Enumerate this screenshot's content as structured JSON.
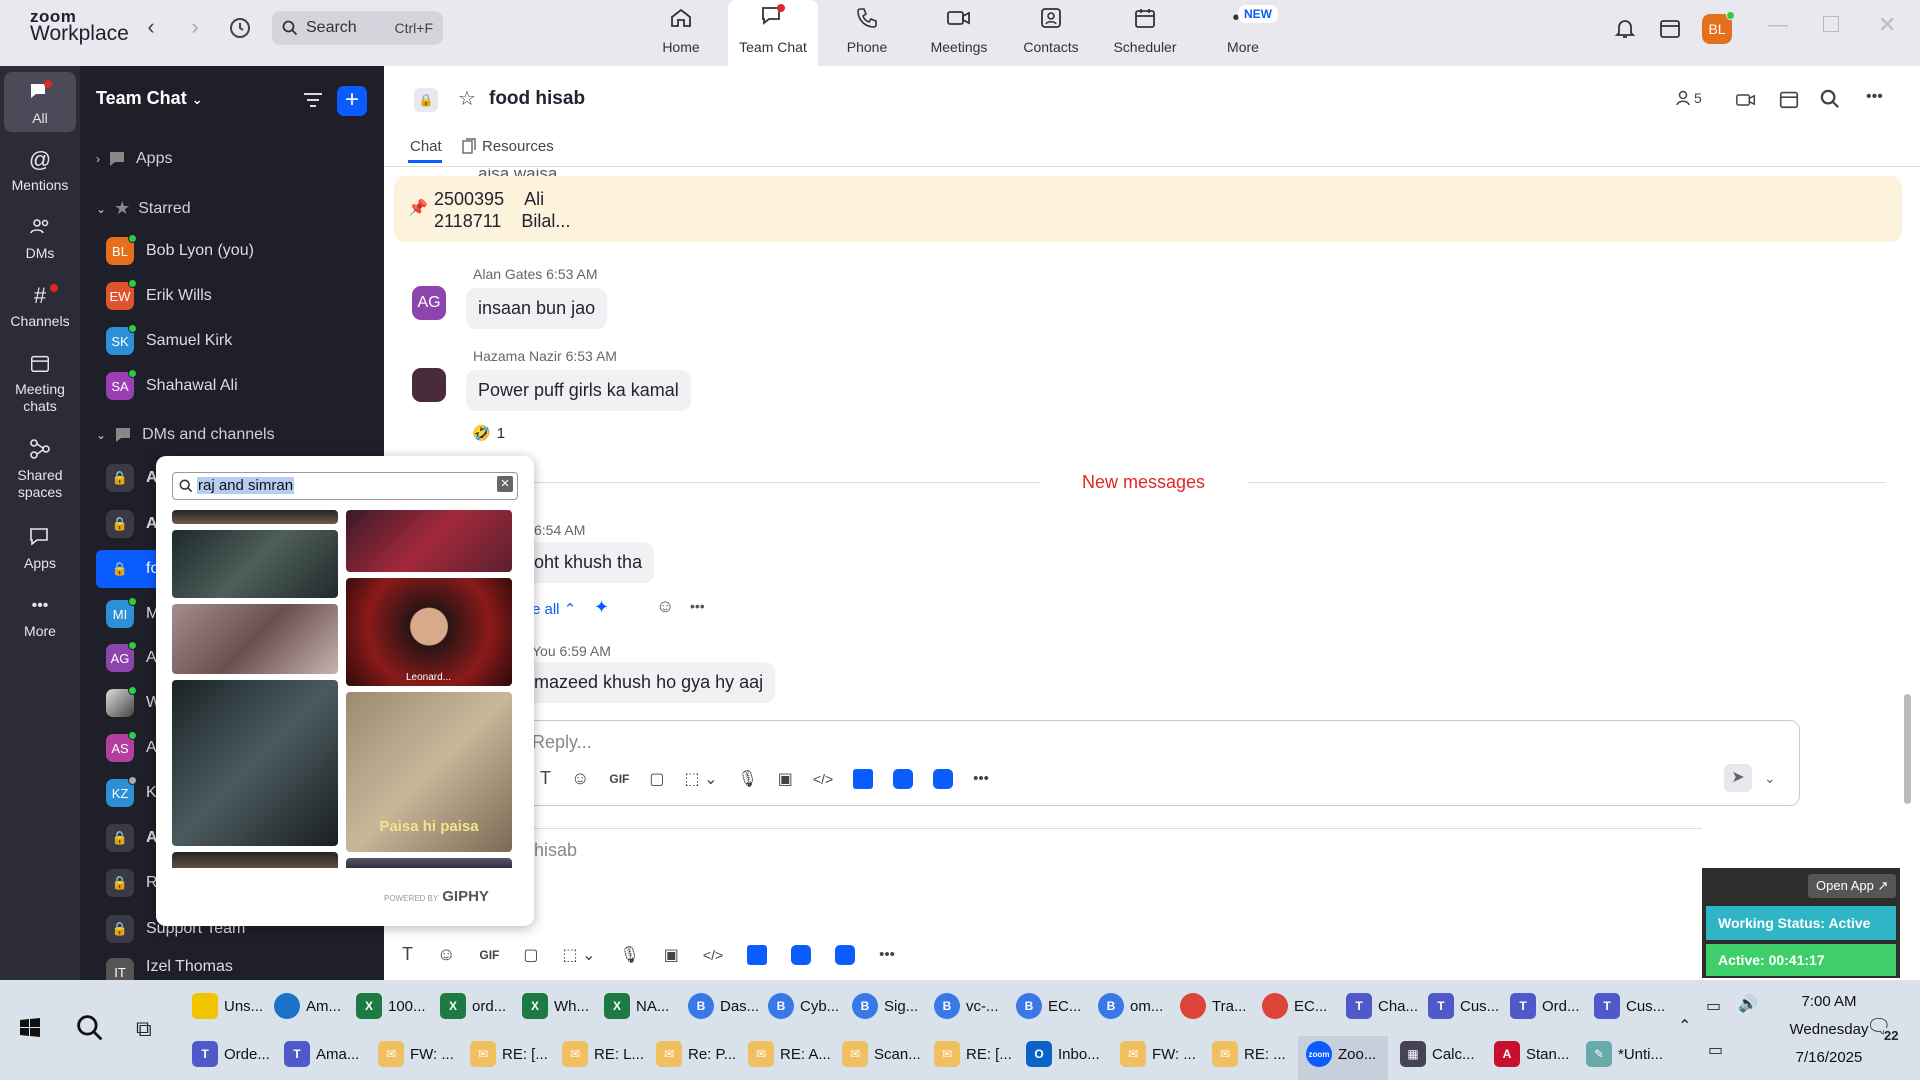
{
  "app": {
    "brand_top": "zoom",
    "brand_bottom": "Workplace"
  },
  "search": {
    "label": "Search",
    "shortcut": "Ctrl+F"
  },
  "top_tabs": [
    {
      "label": "Home",
      "icon": "home-icon"
    },
    {
      "label": "Team Chat",
      "icon": "chat-icon"
    },
    {
      "label": "Phone",
      "icon": "phone-icon"
    },
    {
      "label": "Meetings",
      "icon": "video-icon"
    },
    {
      "label": "Contacts",
      "icon": "contacts-icon"
    },
    {
      "label": "Scheduler",
      "icon": "calendar-icon"
    },
    {
      "label": "More",
      "icon": "more-icon"
    }
  ],
  "new_badge": "NEW",
  "user_avatar": "BL",
  "rail": [
    {
      "label": "All",
      "icon": "chat-icon"
    },
    {
      "label": "Mentions",
      "icon": "at-icon"
    },
    {
      "label": "DMs",
      "icon": "people-icon"
    },
    {
      "label": "Channels",
      "icon": "hash-icon"
    },
    {
      "label": "Meeting chats",
      "icon": "calendar-icon"
    },
    {
      "label": "Shared spaces",
      "icon": "share-icon"
    },
    {
      "label": "Apps",
      "icon": "apps-icon"
    },
    {
      "label": "More",
      "icon": "more-icon"
    }
  ],
  "sidebar": {
    "title": "Team Chat",
    "sections": {
      "apps": "Apps",
      "starred": "Starred",
      "dms": "DMs and channels"
    },
    "starred": [
      {
        "initials": "BL",
        "name": "Bob Lyon (you)",
        "color": "#e4701e"
      },
      {
        "initials": "EW",
        "name": "Erik Wills",
        "color": "#e0532f"
      },
      {
        "initials": "SK",
        "name": "Samuel Kirk",
        "color": "#2d8fd5"
      },
      {
        "initials": "SA",
        "name": "Shahawal Ali",
        "color": "#9b3fb5"
      }
    ],
    "dm_items": [
      {
        "initials": "",
        "name": "A",
        "kind": "lock"
      },
      {
        "initials": "",
        "name": "A",
        "kind": "lock"
      },
      {
        "initials": "",
        "name": "fo",
        "kind": "lock-active"
      },
      {
        "initials": "MI",
        "name": "M",
        "color": "#2d8fd5"
      },
      {
        "initials": "AG",
        "name": "A",
        "color": "#8e44ad"
      },
      {
        "initials": "",
        "name": "W",
        "kind": "photo"
      },
      {
        "initials": "AS",
        "name": "A",
        "color": "#b53fa0"
      },
      {
        "initials": "KZ",
        "name": "K",
        "color": "#2d8fd5"
      },
      {
        "initials": "",
        "name": "A",
        "kind": "lock"
      },
      {
        "initials": "",
        "name": "R",
        "kind": "lock"
      },
      {
        "initials": "",
        "name": "Support Team",
        "kind": "lock"
      },
      {
        "initials": "IT",
        "name": "Izel Thomas",
        "color": "#555"
      }
    ]
  },
  "chat": {
    "title": "food hisab",
    "member_count": "5",
    "tabs": {
      "chat": "Chat",
      "resources": "Resources"
    },
    "partial_top": "aisa waisa",
    "pinned": {
      "line1_num": "2500395",
      "line1_name": "Ali",
      "line2_num": "2118711",
      "line2_name": "Bilal..."
    },
    "messages": [
      {
        "sender": "Alan Gates",
        "time": "6:53 AM",
        "text": "insaan bun jao",
        "initials": "AG",
        "color": "#8e44ad"
      },
      {
        "sender": "Hazama Nazir",
        "time": "6:53 AM",
        "text": "Power puff girls ka kamal",
        "initials": "",
        "color": "#4a2b3a",
        "reaction": "1"
      }
    ],
    "new_messages": "New messages",
    "msg3": {
      "time": "6:54 AM",
      "text": "oht khush tha",
      "see_all": "e all"
    },
    "msg4": {
      "sender": "You",
      "time": "6:59 AM",
      "text": "mazeed khush ho gya hy aaj"
    },
    "reply_placeholder": "Reply...",
    "bottom_placeholder": "hisab"
  },
  "giphy": {
    "query": "raj and simran",
    "gif_captions": [
      "Leonard...",
      "Paisa hi paisa"
    ],
    "powered": "POWERED BY",
    "brand": "GIPHY"
  },
  "status_widget": {
    "open": "Open App",
    "working": "Working Status: Active",
    "active": "Active: 00:41:17"
  },
  "taskbar": {
    "row1": [
      "Uns...",
      "Am...",
      "100...",
      "ord...",
      "Wh...",
      "NA...",
      "Das...",
      "Cyb...",
      "Sig...",
      "vc-...",
      "EC...",
      "om...",
      "Tra...",
      "EC...",
      "Cha...",
      "Cus...",
      "Ord...",
      "Cus..."
    ],
    "row2": [
      "Orde...",
      "Ama...",
      "FW: ...",
      "RE: [...",
      "RE: L...",
      "Re: P...",
      "RE: A...",
      "Scan...",
      "RE: [...",
      "Inbo...",
      "FW: ...",
      "RE: ...",
      "Zoo...",
      "Calc...",
      "Stan...",
      "*Unti..."
    ],
    "time": "7:00 AM",
    "day": "Wednesday",
    "date": "7/16/2025",
    "notif": "22"
  }
}
